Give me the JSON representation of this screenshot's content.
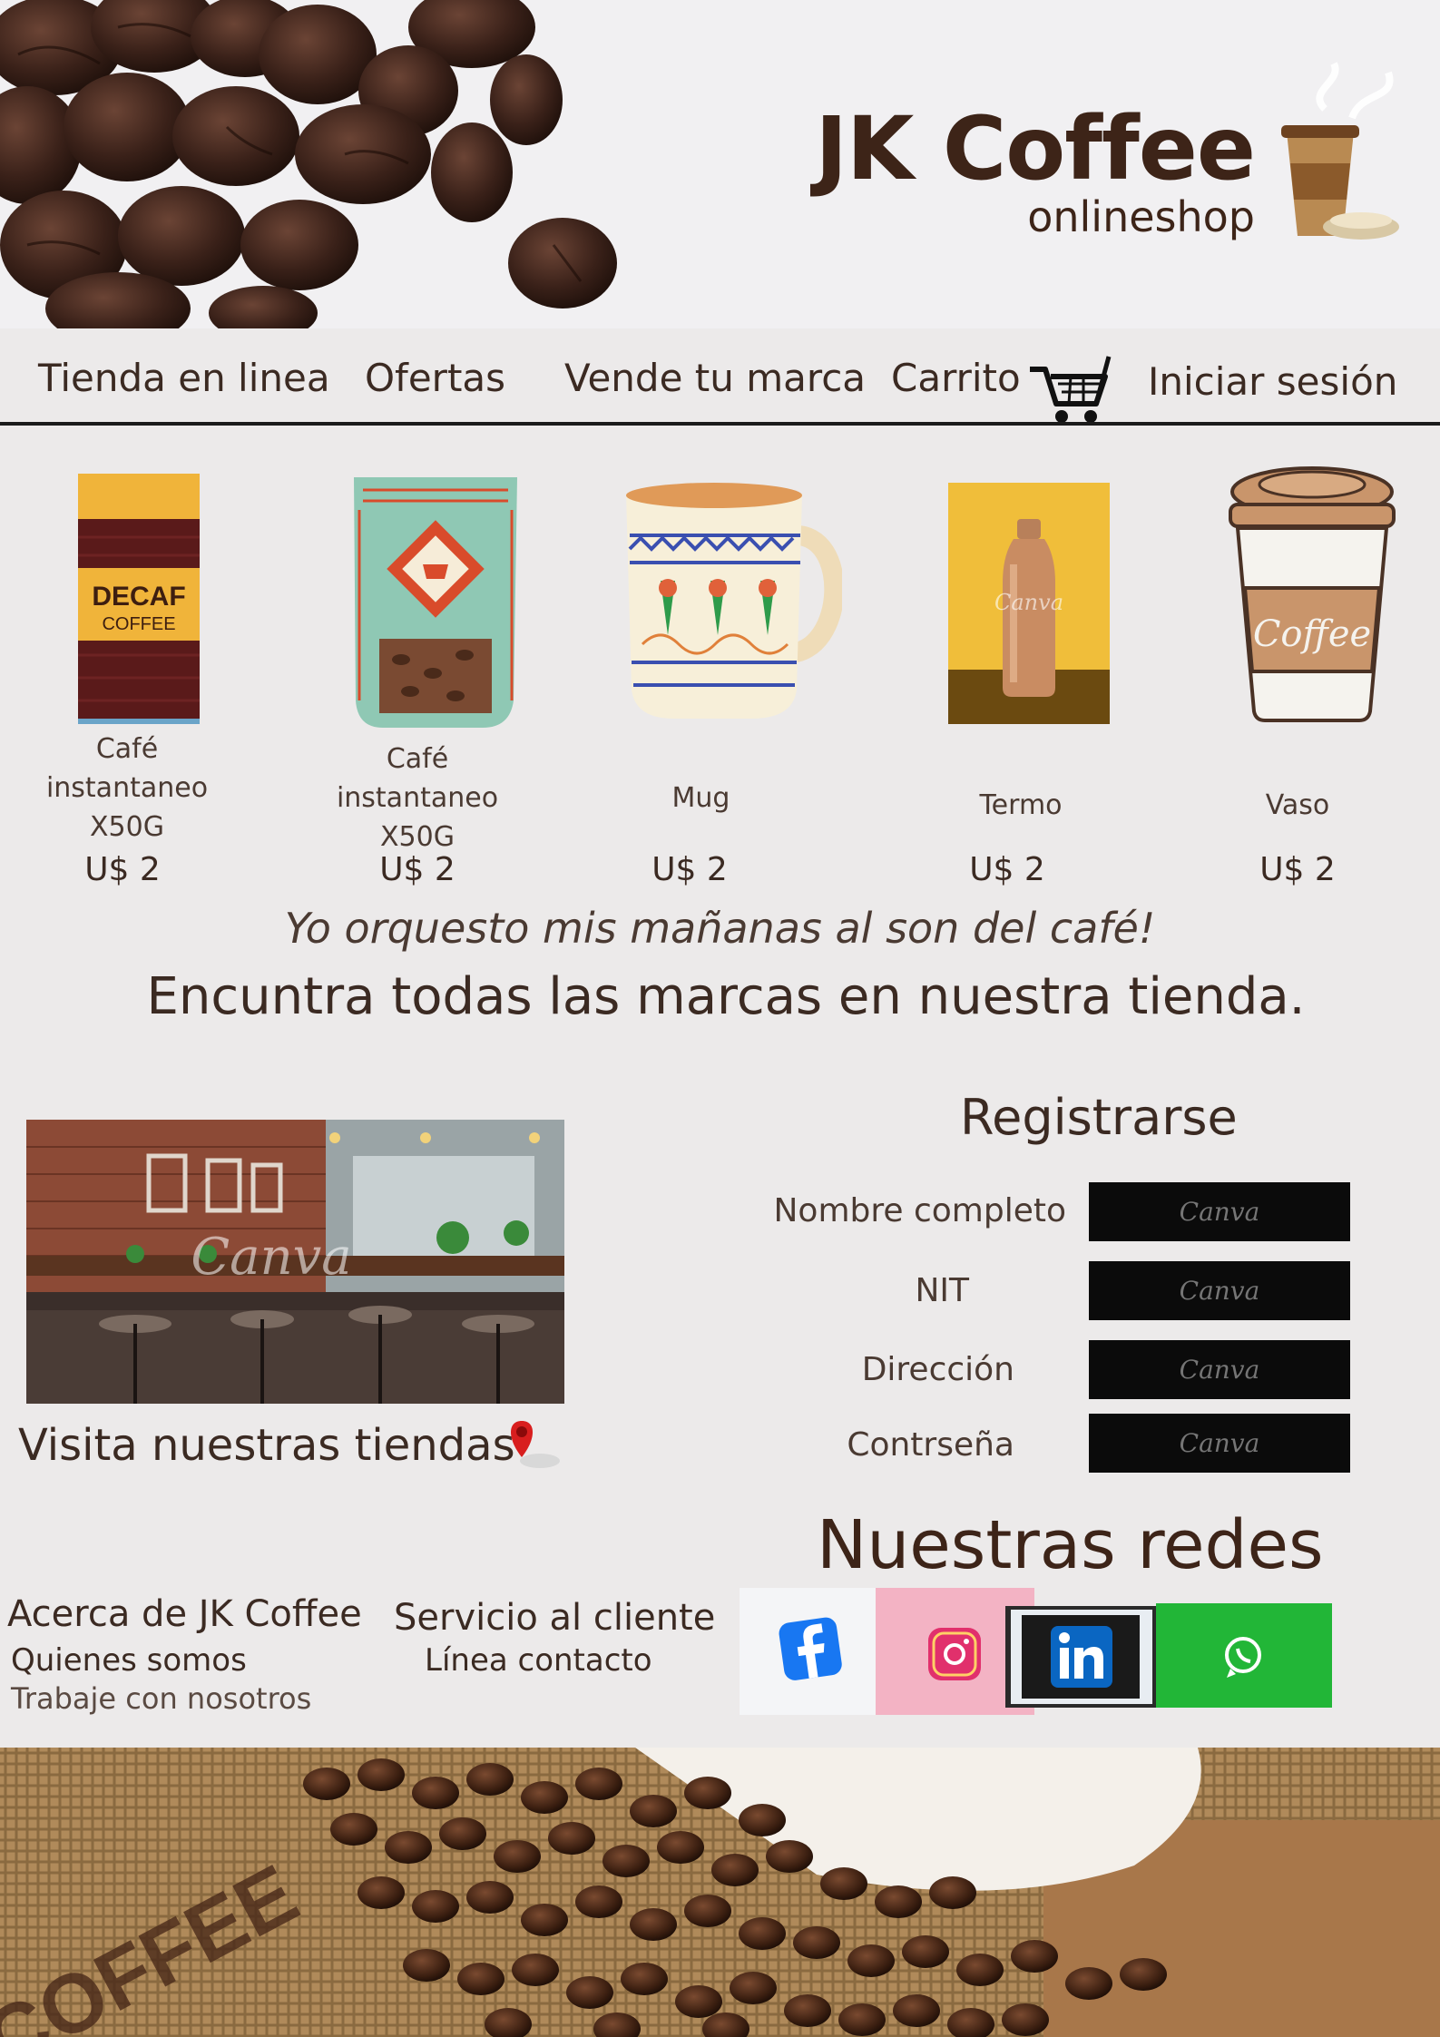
{
  "brand": {
    "title": "JK Coffee",
    "subtitle": "onlineshop"
  },
  "nav": {
    "items": [
      "Tienda en linea",
      "Ofertas",
      "Vende tu marca",
      "Carrito",
      "Iniciar sesión"
    ]
  },
  "products": [
    {
      "name": "Café\ninstantaneo\nX50G",
      "price": "U$ 2",
      "label_top": "DECAF",
      "label_bottom": "COFFEE"
    },
    {
      "name": "Café\ninstantaneo\nX50G",
      "price": "U$ 2"
    },
    {
      "name": "Mug",
      "price": "U$ 2"
    },
    {
      "name": "Termo",
      "price": "U$ 2",
      "watermark": "Canva"
    },
    {
      "name": "Vaso",
      "price": "U$ 2",
      "cup_text": "Coffee"
    }
  ],
  "tagline": "Yo orquesto mis mañanas al son del café!",
  "headline": "Encuntra todas las marcas en nuestra tienda.",
  "store": {
    "visit_text": "Visita nuestras tiendas",
    "watermark": "Canva"
  },
  "register": {
    "title": "Registrarse",
    "fields": [
      {
        "label": "Nombre completo",
        "placeholder": "Canva"
      },
      {
        "label": "NIT",
        "placeholder": "Canva"
      },
      {
        "label": "Dirección",
        "placeholder": "Canva"
      },
      {
        "label": "Contrseña",
        "placeholder": "Canva"
      }
    ]
  },
  "social": {
    "title": "Nuestras redes",
    "icons": [
      "facebook-icon",
      "instagram-icon",
      "linkedin-icon",
      "whatsapp-icon"
    ]
  },
  "footer": {
    "about": {
      "heading": "Acerca de JK Coffee",
      "links": [
        "Quienes somos",
        "Trabaje con nosotros"
      ]
    },
    "service": {
      "heading": "Servicio al cliente",
      "links": [
        "Línea contacto"
      ]
    }
  },
  "bottom_banner": {
    "sack_text": "COFFEE"
  },
  "colors": {
    "brand_brown": "#3d2418",
    "text_brown": "#3b2a22",
    "whatsapp_green": "#22b637",
    "nav_line": "#1b1b1b"
  }
}
